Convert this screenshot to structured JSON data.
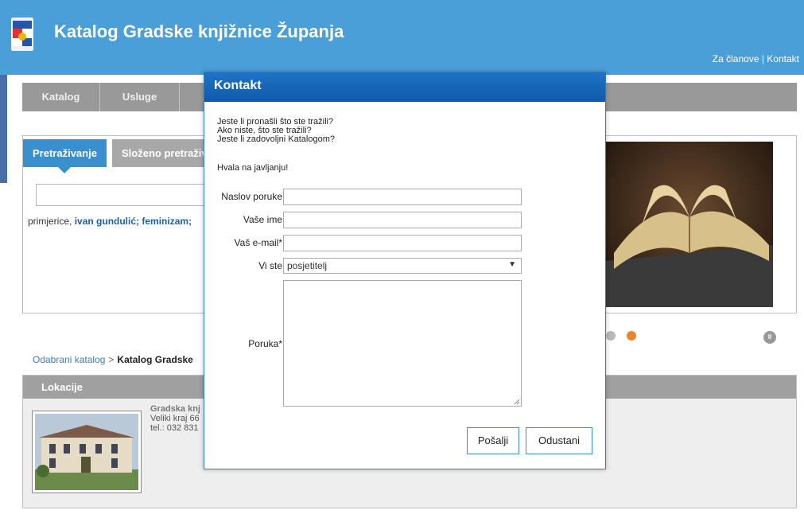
{
  "header": {
    "title": "Katalog Gradske knjižnice Županja",
    "links": {
      "members": "Za članove",
      "separator": " | ",
      "contact": "Kontakt"
    }
  },
  "nav": {
    "items": [
      "Katalog",
      "Usluge"
    ]
  },
  "search": {
    "tabs": [
      "Pretraživanje",
      "Složeno pretraživ"
    ],
    "examples_prefix": "primjerice, ",
    "examples": "ivan gundulić; feminizam; "
  },
  "breadcrumb": {
    "link": "Odabrani katalog",
    "separator": ">",
    "current": "Katalog Gradske"
  },
  "locations": {
    "title": "Lokacije",
    "name": "Gradska knj",
    "address": "Veliki kraj 66",
    "phone": "tel.: 032 831"
  },
  "modal": {
    "title": "Kontakt",
    "intro": [
      "Jeste li pronašli što ste tražili?",
      "Ako niste, što ste tražili?",
      "Jeste li zadovoljni Katalogom?"
    ],
    "thanks": "Hvala na javljanju!",
    "fields": {
      "subject_label": "Naslov poruke",
      "name_label": "Vaše ime",
      "email_label": "Vaš e-mail*",
      "role_label": "Vi ste",
      "role_value": "posjetitelj",
      "message_label": "Poruka*"
    },
    "buttons": {
      "send": "Pošalji",
      "cancel": "Odustani"
    }
  },
  "colors": {
    "header": "#4a9fd8",
    "accent": "#3a8fcf",
    "modal_title": "#1f73c7",
    "dot_active": "#e8862a"
  }
}
